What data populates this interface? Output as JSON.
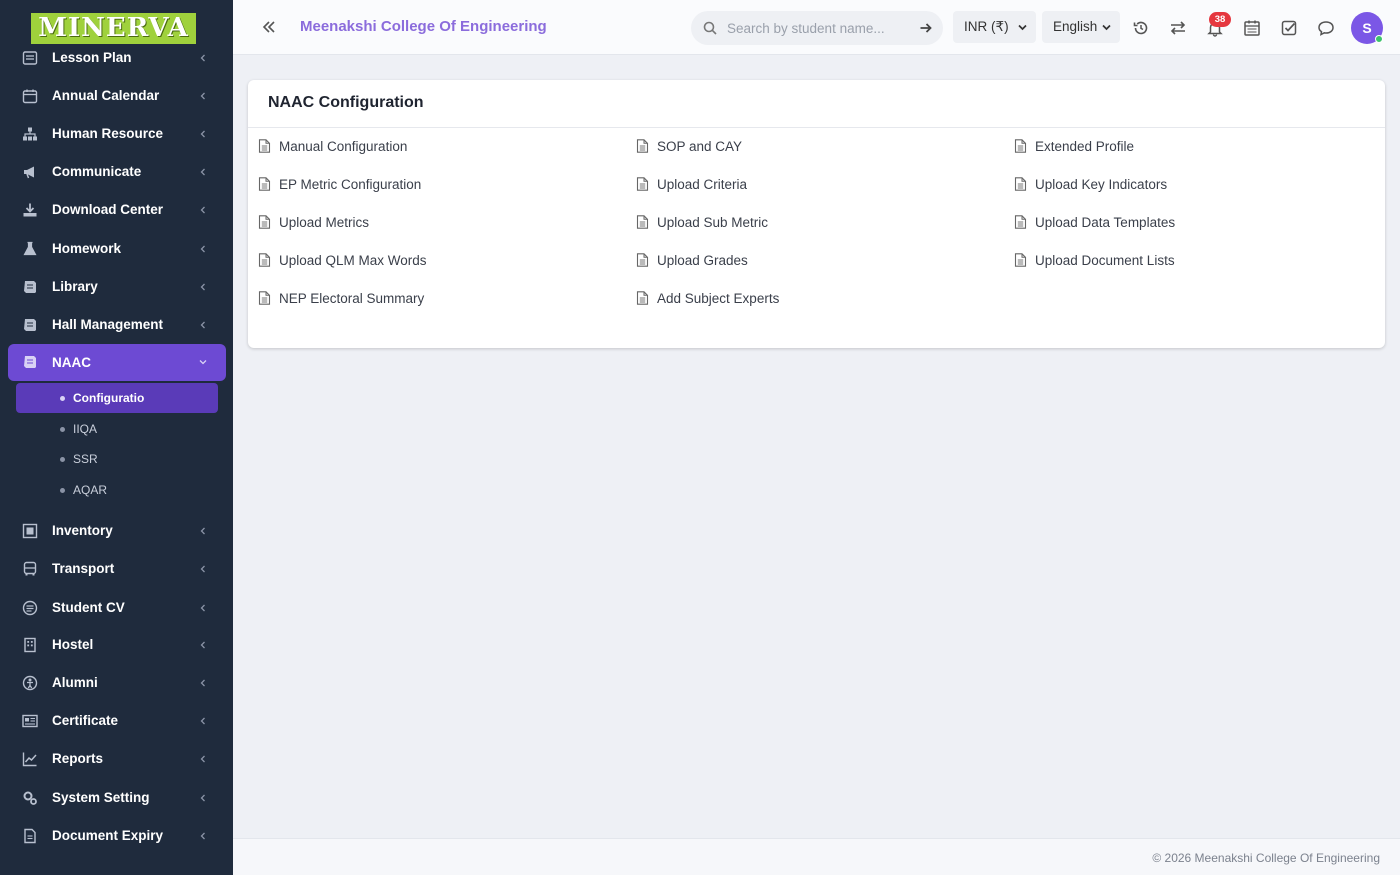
{
  "logo": {
    "text": "MINERVA"
  },
  "sidebar": {
    "items": [
      {
        "label": "Lesson Plan",
        "icon": "lesson-plan-icon"
      },
      {
        "label": "Annual Calendar",
        "icon": "calendar-icon"
      },
      {
        "label": "Human Resource",
        "icon": "org-chart-icon"
      },
      {
        "label": "Communicate",
        "icon": "megaphone-icon"
      },
      {
        "label": "Download Center",
        "icon": "download-icon"
      },
      {
        "label": "Homework",
        "icon": "flask-icon"
      },
      {
        "label": "Library",
        "icon": "book-icon"
      },
      {
        "label": "Hall Management",
        "icon": "book-icon"
      },
      {
        "label": "NAAC",
        "icon": "book-icon"
      },
      {
        "label": "Inventory",
        "icon": "inventory-icon"
      },
      {
        "label": "Transport",
        "icon": "bus-icon"
      },
      {
        "label": "Student CV",
        "icon": "cv-icon"
      },
      {
        "label": "Hostel",
        "icon": "building-icon"
      },
      {
        "label": "Alumni",
        "icon": "alumni-icon"
      },
      {
        "label": "Certificate",
        "icon": "certificate-icon"
      },
      {
        "label": "Reports",
        "icon": "chart-line-icon"
      },
      {
        "label": "System Setting",
        "icon": "gears-icon"
      },
      {
        "label": "Document Expiry",
        "icon": "document-icon"
      }
    ],
    "naac_sub": [
      {
        "label": "Configuratio"
      },
      {
        "label": "IIQA"
      },
      {
        "label": "SSR"
      },
      {
        "label": "AQAR"
      }
    ]
  },
  "header": {
    "college": "Meenakshi College Of Engineering",
    "search_placeholder": "Search by student name...",
    "currency": "INR (₹)",
    "language": "English",
    "notifications": "38",
    "avatar": "S"
  },
  "card": {
    "title": "NAAC Configuration",
    "links": [
      {
        "label": "Manual Configuration"
      },
      {
        "label": "SOP and CAY"
      },
      {
        "label": "Extended Profile"
      },
      {
        "label": "EP Metric Configuration"
      },
      {
        "label": "Upload Criteria"
      },
      {
        "label": "Upload Key Indicators"
      },
      {
        "label": "Upload Metrics"
      },
      {
        "label": "Upload Sub Metric"
      },
      {
        "label": "Upload Data Templates"
      },
      {
        "label": "Upload QLM Max Words"
      },
      {
        "label": "Upload Grades"
      },
      {
        "label": "Upload Document Lists"
      },
      {
        "label": "NEP Electoral Summary"
      },
      {
        "label": "Add Subject Experts"
      }
    ]
  },
  "footer": {
    "text": "© 2026 Meenakshi College Of Engineering"
  },
  "colors": {
    "accent": "#6d4ad3",
    "sidebar": "#1f2b3d",
    "title": "#8b6cdc",
    "logo": "#9fd13c"
  }
}
